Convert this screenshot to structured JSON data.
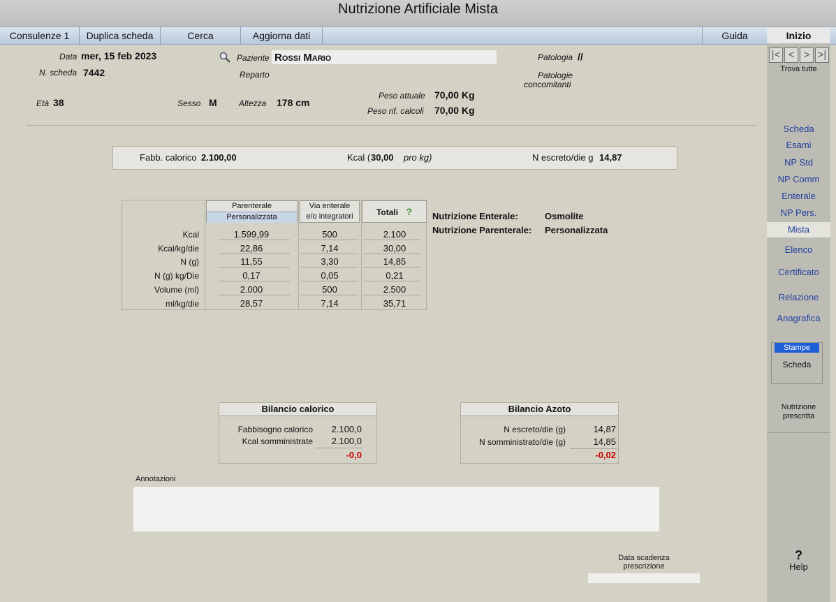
{
  "title": "Nutrizione Artificiale Mista",
  "menu": {
    "consulenze": "Consulenze 1",
    "duplica": "Duplica scheda",
    "cerca": "Cerca",
    "aggiorna": "Aggiorna dati",
    "guida": "Guida",
    "inizio": "Inizio"
  },
  "header": {
    "data_label": "Data",
    "data_value": "mer, 15 feb 2023",
    "nscheda_label": "N. scheda",
    "nscheda_value": "7442",
    "paziente_label": "Paziente",
    "paziente_value": "Rossi Mario",
    "reparto_label": "Reparto",
    "patologia_label": "Patologia",
    "patologia_value": "//",
    "patologie_conc_label_1": "Patologie",
    "patologie_conc_label_2": "concomitanti",
    "eta_label": "Età",
    "eta_value": "38",
    "sesso_label": "Sesso",
    "sesso_value": "M",
    "altezza_label": "Altezza",
    "altezza_value": "178 cm",
    "peso_attuale_label": "Peso attuale",
    "peso_attuale_value": "70,00 Kg",
    "peso_rif_label": "Peso rif. calcoli",
    "peso_rif_value": "70,00 Kg"
  },
  "summary": {
    "fabb_label": "Fabb. calorico",
    "fabb_value": "2.100,00",
    "kcal_label": "Kcal (",
    "kcal_value": "30,00",
    "kcal_unit": "pro kg)",
    "nescreto_label": "N escreto/die g",
    "nescreto_value": "14,87"
  },
  "table": {
    "col1_l1": "Parenterale",
    "col1_l2": "Personalizzata",
    "col2_l1": "Via enterale",
    "col2_l2": "e/o integratori",
    "col3": "Totali",
    "help": "?",
    "rows": [
      {
        "label": "Kcal",
        "p": "1.599,99",
        "e": "500",
        "t": "2.100"
      },
      {
        "label": "Kcal/kg/die",
        "p": "22,86",
        "e": "7,14",
        "t": "30,00"
      },
      {
        "label": "N  (g)",
        "p": "11,55",
        "e": "3,30",
        "t": "14,85"
      },
      {
        "label": "N (g)  kg/Die",
        "p": "0,17",
        "e": "0,05",
        "t": "0,21"
      },
      {
        "label": "Volume (ml)",
        "p": "2.000",
        "e": "500",
        "t": "2.500"
      },
      {
        "label": "ml/kg/die",
        "p": "28,57",
        "e": "7,14",
        "t": "35,71"
      }
    ]
  },
  "nutrition_info": {
    "enterale_label": "Nutrizione Enterale:",
    "enterale_value": "Osmolite",
    "parenterale_label": "Nutrizione Parenterale:",
    "parenterale_value": "Personalizzata"
  },
  "bilancio_calorico": {
    "title": "Bilancio calorico",
    "row1_label": "Fabbisogno calorico",
    "row1_value": "2.100,0",
    "row2_label": "Kcal somministrate",
    "row2_value": "2.100,0",
    "result": "-0,0"
  },
  "bilancio_azoto": {
    "title": "Bilancio Azoto",
    "row1_label": "N escreto/die (g)",
    "row1_value": "14,87",
    "row2_label": "N somministrato/die (g)",
    "row2_value": "14,85",
    "result": "-0,02"
  },
  "annotazioni_label": "Annotazioni",
  "scadenza_label_1": "Data scadenza",
  "scadenza_label_2": "prescrizione",
  "sidebar": {
    "nav": [
      "|<",
      "<",
      ">",
      ">|"
    ],
    "trova": "Trova tutte",
    "items": [
      "Scheda",
      "Esami",
      "NP Std",
      "NP Comm",
      "Enterale",
      "NP Pers.",
      "Mista",
      "Elenco",
      "Certificato",
      "Relazione",
      "Anagrafica"
    ],
    "stampe": "Stampe",
    "stampe_scheda": "Scheda",
    "nutrizione_1": "Nutrizione",
    "nutrizione_2": "prescritta",
    "help_q": "?",
    "help": "Help"
  },
  "colors": {
    "background": "#d4d2c5",
    "sidebar": "#bdbcb4",
    "link": "#1f3fa0",
    "negative": "#c90000",
    "help_green": "#3b8a2e"
  }
}
